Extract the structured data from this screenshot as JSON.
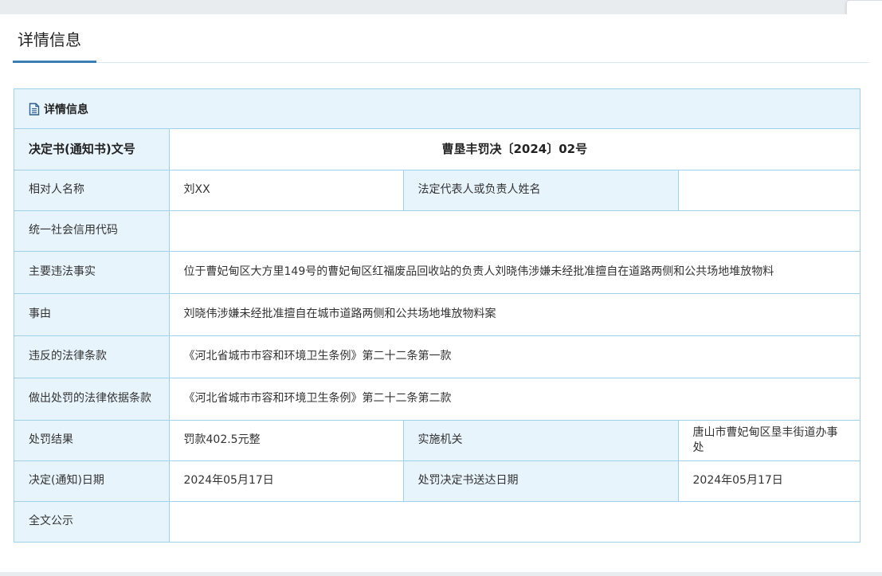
{
  "page": {
    "title": "详情信息"
  },
  "detail": {
    "header": {
      "icon": "document-icon",
      "title": "详情信息"
    },
    "doc_number": {
      "label": "决定书(通知书)文号",
      "value": "曹垦丰罚决〔2024〕02号"
    },
    "party_name": {
      "label": "相对人名称",
      "value": "刘XX"
    },
    "legal_rep": {
      "label": "法定代表人或负责人姓名",
      "value": ""
    },
    "credit_code": {
      "label": "统一社会信用代码",
      "value": ""
    },
    "main_facts": {
      "label": "主要违法事实",
      "value": "位于曹妃甸区大方里149号的曹妃甸区红福废品回收站的负责人刘晓伟涉嫌未经批准擅自在道路两侧和公共场地堆放物料"
    },
    "cause": {
      "label": "事由",
      "value": "刘晓伟涉嫌未经批准擅自在城市道路两侧和公共场地堆放物料案"
    },
    "violated_law": {
      "label": "违反的法律条款",
      "value": "《河北省城市市容和环境卫生条例》第二十二条第一款"
    },
    "penalty_basis": {
      "label": "做出处罚的法律依据条款",
      "value": "《河北省城市市容和环境卫生条例》第二十二条第二款"
    },
    "penalty_result": {
      "label": "处罚结果",
      "value": "罚款402.5元整"
    },
    "agency": {
      "label": "实施机关",
      "value": "唐山市曹妃甸区垦丰街道办事处"
    },
    "decision_date": {
      "label": "决定(通知)日期",
      "value": "2024年05月17日"
    },
    "delivery_date": {
      "label": "处罚决定书送达日期",
      "value": "2024年05月17日"
    },
    "full_text": {
      "label": "全文公示",
      "value": ""
    }
  }
}
